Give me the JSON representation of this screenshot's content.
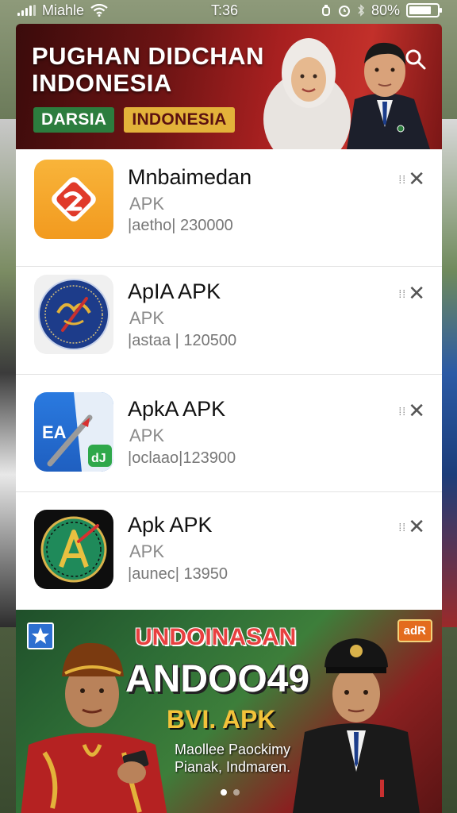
{
  "status_bar": {
    "carrier": "Miahle",
    "time": "T:36",
    "battery_percent": "80%",
    "battery_level": 0.8
  },
  "top_banner": {
    "title": "PUGHAN DIDCHAN INDONESIA",
    "tag_green": "DARSIA",
    "tag_gold": "INDONESIA",
    "search_icon": "search-icon"
  },
  "apps": [
    {
      "name": "Mnbaimedan",
      "type": "APK",
      "meta": "|aetho| 230000",
      "icon": "orange-diamond-app-icon"
    },
    {
      "name": "ApIA APK",
      "type": "APK",
      "meta": "|astaa | 120500",
      "icon": "emblem-seal-app-icon"
    },
    {
      "name": "ApkA APK",
      "type": "APK",
      "meta": "|oclaao|123900",
      "icon": "ea-pencil-app-icon"
    },
    {
      "name": "Apk APK",
      "type": "APK",
      "meta": "|aunec| 13950",
      "icon": "green-compass-app-icon"
    }
  ],
  "dismiss_label": "✕",
  "bottom_banner": {
    "headline": "UNDOINASAN",
    "big_text": "ANDOO49",
    "sub_text": "BVI. APK",
    "desc_line1": "Maollee Paockimy",
    "desc_line2": "Pianak, Indmaren.",
    "badge_right": "adR",
    "page_count": 2,
    "active_page": 1
  },
  "colors": {
    "banner_red": "#a82020",
    "tag_green": "#2c7d3e",
    "tag_gold": "#e3b23a",
    "list_bg": "#ffffff"
  }
}
